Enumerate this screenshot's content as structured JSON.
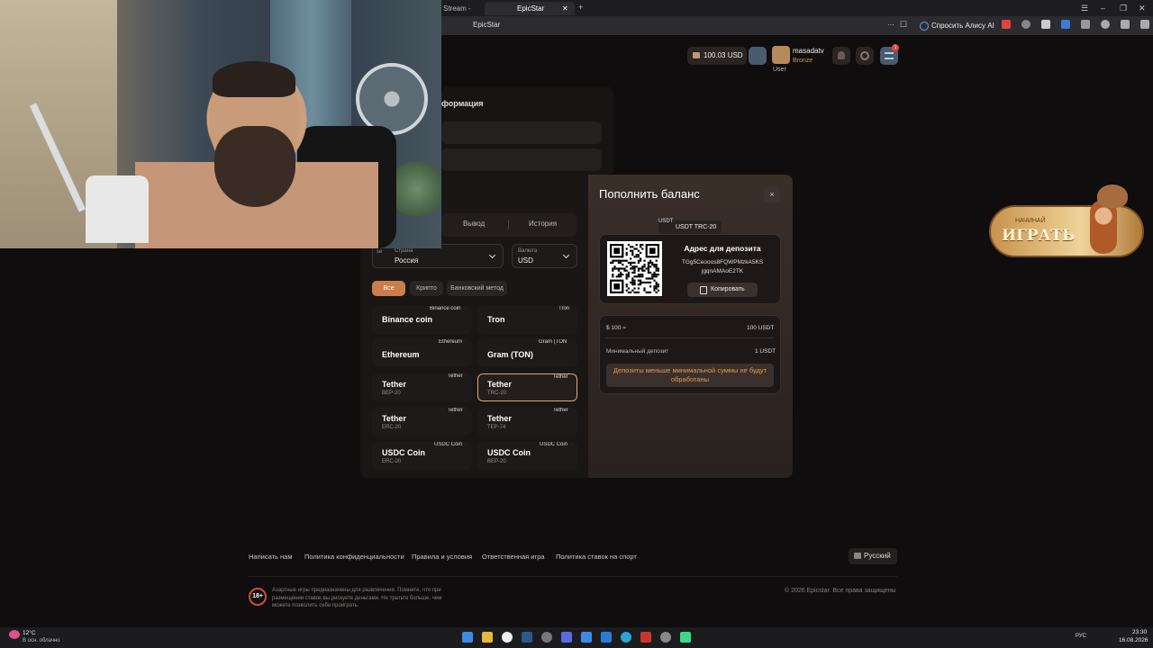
{
  "browser": {
    "tabs": [
      {
        "label": "Stream - Wat:"
      },
      {
        "label": "EpicStar"
      }
    ],
    "address": "EpicStar",
    "ask_alice": "Спросить Алису AI"
  },
  "header": {
    "balance": "100.03 USD",
    "username": "masadatv",
    "rank": "Bronze",
    "role_label": "User",
    "notifications_count": "1"
  },
  "profile": {
    "section_title": "формация"
  },
  "modal": {
    "title": "Пополнить баланс",
    "close_label": "×",
    "tabs": [
      "Вывод",
      "История"
    ],
    "country": {
      "label": "Страна",
      "value": "Россия",
      "img_alt": "se"
    },
    "currency": {
      "label": "Валюта",
      "value": "USD"
    },
    "filters": [
      "Все",
      "Крипто",
      "Банковский метод"
    ],
    "coins": [
      {
        "name": "Binance coin",
        "network": "",
        "img_alt": "Binance coin"
      },
      {
        "name": "Tron",
        "network": "",
        "img_alt": "Tron"
      },
      {
        "name": "Ethereum",
        "network": "",
        "img_alt": "Ethereum"
      },
      {
        "name": "Gram (TON)",
        "network": "",
        "img_alt": "Gram (TON"
      },
      {
        "name": "Tether",
        "network": "BEP-20",
        "img_alt": "Tether"
      },
      {
        "name": "Tether",
        "network": "TRC-20",
        "img_alt": "Tether"
      },
      {
        "name": "Tether",
        "network": "ERC-20",
        "img_alt": "Tether"
      },
      {
        "name": "Tether",
        "network": "TEP-74",
        "img_alt": "Tether"
      },
      {
        "name": "USDC Coin",
        "network": "ERC-20",
        "img_alt": "USDC Coin"
      },
      {
        "name": "USDC Coin",
        "network": "BEP-20",
        "img_alt": "USDC Coin"
      }
    ],
    "deposit": {
      "img_alt": "USDT",
      "network_chip": "USDT TRC-20",
      "address_title": "Адрес для депозита",
      "address": "TGg5Ceooos8FQWPMzkA5KS jgqnAMAoE2TK",
      "copy_label": "Копировать",
      "amount_label": "$ 100 ≈",
      "amount_value": "100 USDT",
      "min_label": "Минимальный депозит",
      "min_value": "1 USDT",
      "warning": "Депозиты меньше минимальной суммы не будут обработаны"
    }
  },
  "promo": {
    "subtitle": "НАЧИНАЙ",
    "title": "ИГРАТЬ"
  },
  "footer": {
    "links": [
      "Написать нам",
      "Политика конфиденциальности",
      "Правила и условия",
      "Ответственная игра",
      "Политика ставок на спорт"
    ],
    "language": "Русский",
    "age": "18+",
    "disclaimer": "Азартные игры предназначены для развлечения. Помните, что при размещении ставок вы рискуете деньгами. Не тратьте больше, чем можете позволить себе проиграть.",
    "copyright": "© 2026 Epicstar. Все права защищены"
  },
  "taskbar": {
    "temperature": "12°C",
    "weather": "В осн. облачно",
    "lang": "РУС",
    "time": "23:30",
    "date": "16.08.2026"
  },
  "colors": {
    "accent": "#c97e4b",
    "warning": "#e69a4b",
    "selected_border": "#d6b06b"
  }
}
